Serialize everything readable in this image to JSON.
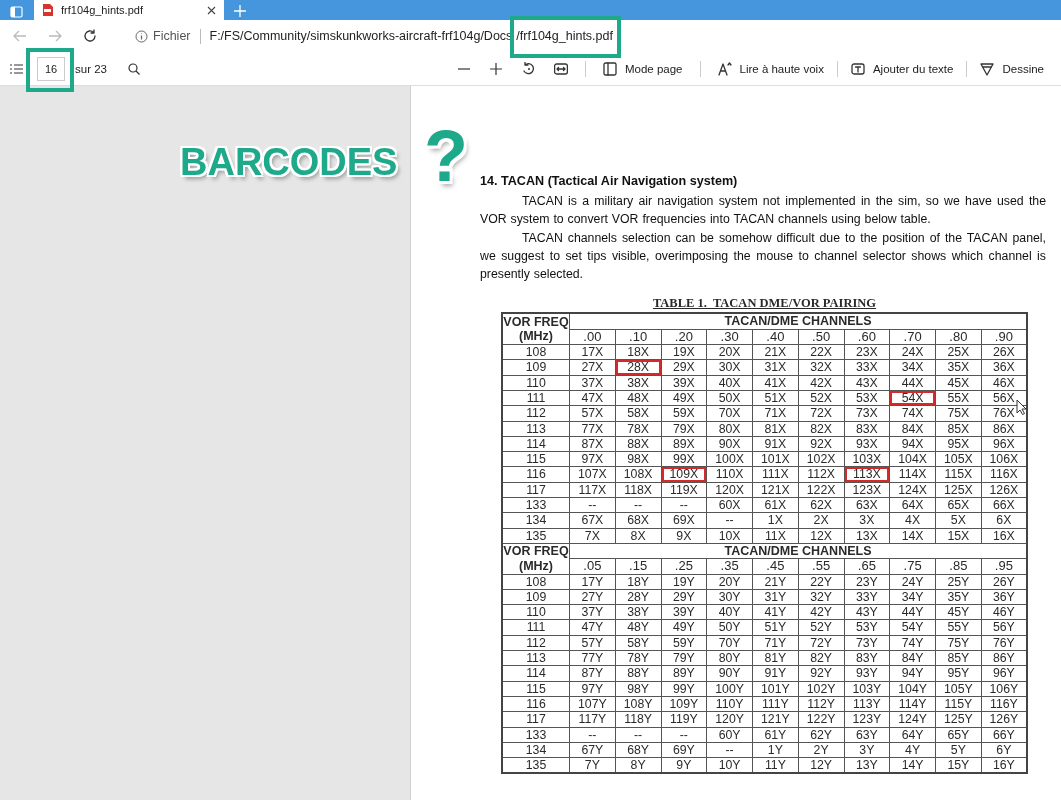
{
  "browser": {
    "tab_title": "frf104g_hints.pdf",
    "scheme_label": "Fichier",
    "url_path": "F:/FS/Community/simskunkworks-aircraft-frf104g/Docs",
    "url_file": "/frf104g_hints.pdf",
    "url_file_highlighted": true
  },
  "pdf_toolbar": {
    "page": "16",
    "page_highlighted": true,
    "page_total": "sur 23",
    "buttons": [
      {
        "kind": "pagemode",
        "label": "Mode page"
      },
      {
        "kind": "read",
        "label": "Lire à haute voix"
      },
      {
        "kind": "text",
        "label": "Ajouter du texte"
      },
      {
        "kind": "draw",
        "label": "Dessine"
      }
    ]
  },
  "annotation": {
    "label": "BARCODES",
    "mark": "?"
  },
  "document": {
    "heading": "14. TACAN (Tactical Air Navigation system)",
    "paragraphs": [
      "TACAN is a military air navigation system not implemented  in the sim, so we have used the VOR system to convert VOR frequencies into TACAN channels using below table.",
      "TACAN channels selection can be somehow difficult due to the position of the TACAN panel, we suggest to set tips visible, overimposing the mouse to channel selector shows which channel is presently selected."
    ],
    "table": {
      "caption": "TABLE 1.  TACAN DME/VOR PAIRING",
      "blocks": [
        {
          "freq_label": "VOR FREQ",
          "freq_unit": "(MHz)",
          "group_label": "TACAN/DME CHANNELS",
          "columns": [
            ".00",
            ".10",
            ".20",
            ".30",
            ".40",
            ".50",
            ".60",
            ".70",
            ".80",
            ".90"
          ],
          "rows": [
            {
              "freq": "108",
              "cells": [
                {
                  "text": "17X",
                  "boxed": false
                },
                {
                  "text": "18X",
                  "boxed": false
                },
                {
                  "text": "19X",
                  "boxed": false
                },
                {
                  "text": "20X",
                  "boxed": false
                },
                {
                  "text": "21X",
                  "boxed": false
                },
                {
                  "text": "22X",
                  "boxed": false
                },
                {
                  "text": "23X",
                  "boxed": false
                },
                {
                  "text": "24X",
                  "boxed": false
                },
                {
                  "text": "25X",
                  "boxed": false
                },
                {
                  "text": "26X",
                  "boxed": false
                }
              ]
            },
            {
              "freq": "109",
              "cells": [
                {
                  "text": "27X",
                  "boxed": false
                },
                {
                  "text": "28X",
                  "boxed": true
                },
                {
                  "text": "29X",
                  "boxed": false
                },
                {
                  "text": "30X",
                  "boxed": false
                },
                {
                  "text": "31X",
                  "boxed": false
                },
                {
                  "text": "32X",
                  "boxed": false
                },
                {
                  "text": "33X",
                  "boxed": false
                },
                {
                  "text": "34X",
                  "boxed": false
                },
                {
                  "text": "35X",
                  "boxed": false
                },
                {
                  "text": "36X",
                  "boxed": false
                }
              ]
            },
            {
              "freq": "110",
              "cells": [
                {
                  "text": "37X",
                  "boxed": false
                },
                {
                  "text": "38X",
                  "boxed": false
                },
                {
                  "text": "39X",
                  "boxed": false
                },
                {
                  "text": "40X",
                  "boxed": false
                },
                {
                  "text": "41X",
                  "boxed": false
                },
                {
                  "text": "42X",
                  "boxed": false
                },
                {
                  "text": "43X",
                  "boxed": false
                },
                {
                  "text": "44X",
                  "boxed": false
                },
                {
                  "text": "45X",
                  "boxed": false
                },
                {
                  "text": "46X",
                  "boxed": false
                }
              ]
            },
            {
              "freq": "111",
              "cells": [
                {
                  "text": "47X",
                  "boxed": false
                },
                {
                  "text": "48X",
                  "boxed": false
                },
                {
                  "text": "49X",
                  "boxed": false
                },
                {
                  "text": "50X",
                  "boxed": false
                },
                {
                  "text": "51X",
                  "boxed": false
                },
                {
                  "text": "52X",
                  "boxed": false
                },
                {
                  "text": "53X",
                  "boxed": false
                },
                {
                  "text": "54X",
                  "boxed": true
                },
                {
                  "text": "55X",
                  "boxed": false
                },
                {
                  "text": "56X",
                  "boxed": false
                }
              ]
            },
            {
              "freq": "112",
              "cells": [
                {
                  "text": "57X",
                  "boxed": false
                },
                {
                  "text": "58X",
                  "boxed": false
                },
                {
                  "text": "59X",
                  "boxed": false
                },
                {
                  "text": "70X",
                  "boxed": false
                },
                {
                  "text": "71X",
                  "boxed": false
                },
                {
                  "text": "72X",
                  "boxed": false
                },
                {
                  "text": "73X",
                  "boxed": false
                },
                {
                  "text": "74X",
                  "boxed": false
                },
                {
                  "text": "75X",
                  "boxed": false
                },
                {
                  "text": "76X",
                  "boxed": false
                }
              ]
            },
            {
              "freq": "113",
              "cells": [
                {
                  "text": "77X",
                  "boxed": false
                },
                {
                  "text": "78X",
                  "boxed": false
                },
                {
                  "text": "79X",
                  "boxed": false
                },
                {
                  "text": "80X",
                  "boxed": false
                },
                {
                  "text": "81X",
                  "boxed": false
                },
                {
                  "text": "82X",
                  "boxed": false
                },
                {
                  "text": "83X",
                  "boxed": false
                },
                {
                  "text": "84X",
                  "boxed": false
                },
                {
                  "text": "85X",
                  "boxed": false
                },
                {
                  "text": "86X",
                  "boxed": false
                }
              ]
            },
            {
              "freq": "114",
              "cells": [
                {
                  "text": "87X",
                  "boxed": false
                },
                {
                  "text": "88X",
                  "boxed": false
                },
                {
                  "text": "89X",
                  "boxed": false
                },
                {
                  "text": "90X",
                  "boxed": false
                },
                {
                  "text": "91X",
                  "boxed": false
                },
                {
                  "text": "92X",
                  "boxed": false
                },
                {
                  "text": "93X",
                  "boxed": false
                },
                {
                  "text": "94X",
                  "boxed": false
                },
                {
                  "text": "95X",
                  "boxed": false
                },
                {
                  "text": "96X",
                  "boxed": false
                }
              ]
            },
            {
              "freq": "115",
              "cells": [
                {
                  "text": "97X",
                  "boxed": false
                },
                {
                  "text": "98X",
                  "boxed": false
                },
                {
                  "text": "99X",
                  "boxed": false
                },
                {
                  "text": "100X",
                  "boxed": false
                },
                {
                  "text": "101X",
                  "boxed": false
                },
                {
                  "text": "102X",
                  "boxed": false
                },
                {
                  "text": "103X",
                  "boxed": false
                },
                {
                  "text": "104X",
                  "boxed": false
                },
                {
                  "text": "105X",
                  "boxed": false
                },
                {
                  "text": "106X",
                  "boxed": false
                }
              ]
            },
            {
              "freq": "116",
              "cells": [
                {
                  "text": "107X",
                  "boxed": false
                },
                {
                  "text": "108X",
                  "boxed": false
                },
                {
                  "text": "109X",
                  "boxed": true
                },
                {
                  "text": "110X",
                  "boxed": false
                },
                {
                  "text": "111X",
                  "boxed": false
                },
                {
                  "text": "112X",
                  "boxed": false
                },
                {
                  "text": "113X",
                  "boxed": true
                },
                {
                  "text": "114X",
                  "boxed": false
                },
                {
                  "text": "115X",
                  "boxed": false
                },
                {
                  "text": "116X",
                  "boxed": false
                }
              ]
            },
            {
              "freq": "117",
              "cells": [
                {
                  "text": "117X",
                  "boxed": false
                },
                {
                  "text": "118X",
                  "boxed": false
                },
                {
                  "text": "119X",
                  "boxed": false
                },
                {
                  "text": "120X",
                  "boxed": false
                },
                {
                  "text": "121X",
                  "boxed": false
                },
                {
                  "text": "122X",
                  "boxed": false
                },
                {
                  "text": "123X",
                  "boxed": false
                },
                {
                  "text": "124X",
                  "boxed": false
                },
                {
                  "text": "125X",
                  "boxed": false
                },
                {
                  "text": "126X",
                  "boxed": false
                }
              ]
            },
            {
              "freq": "133",
              "cells": [
                {
                  "text": "--",
                  "boxed": false
                },
                {
                  "text": "--",
                  "boxed": false
                },
                {
                  "text": "--",
                  "boxed": false
                },
                {
                  "text": "60X",
                  "boxed": false
                },
                {
                  "text": "61X",
                  "boxed": false
                },
                {
                  "text": "62X",
                  "boxed": false
                },
                {
                  "text": "63X",
                  "boxed": false
                },
                {
                  "text": "64X",
                  "boxed": false
                },
                {
                  "text": "65X",
                  "boxed": false
                },
                {
                  "text": "66X",
                  "boxed": false
                }
              ]
            },
            {
              "freq": "134",
              "cells": [
                {
                  "text": "67X",
                  "boxed": false
                },
                {
                  "text": "68X",
                  "boxed": false
                },
                {
                  "text": "69X",
                  "boxed": false
                },
                {
                  "text": "--",
                  "boxed": false
                },
                {
                  "text": "1X",
                  "boxed": false
                },
                {
                  "text": "2X",
                  "boxed": false
                },
                {
                  "text": "3X",
                  "boxed": false
                },
                {
                  "text": "4X",
                  "boxed": false
                },
                {
                  "text": "5X",
                  "boxed": false
                },
                {
                  "text": "6X",
                  "boxed": false
                }
              ]
            },
            {
              "freq": "135",
              "cells": [
                {
                  "text": "7X",
                  "boxed": false
                },
                {
                  "text": "8X",
                  "boxed": false
                },
                {
                  "text": "9X",
                  "boxed": false
                },
                {
                  "text": "10X",
                  "boxed": false
                },
                {
                  "text": "11X",
                  "boxed": false
                },
                {
                  "text": "12X",
                  "boxed": false
                },
                {
                  "text": "13X",
                  "boxed": false
                },
                {
                  "text": "14X",
                  "boxed": false
                },
                {
                  "text": "15X",
                  "boxed": false
                },
                {
                  "text": "16X",
                  "boxed": false
                }
              ]
            }
          ]
        },
        {
          "freq_label": "VOR FREQ",
          "freq_unit": "(MHz)",
          "group_label": "TACAN/DME CHANNELS",
          "columns": [
            ".05",
            ".15",
            ".25",
            ".35",
            ".45",
            ".55",
            ".65",
            ".75",
            ".85",
            ".95"
          ],
          "rows": [
            {
              "freq": "108",
              "cells": [
                {
                  "text": "17Y",
                  "boxed": false
                },
                {
                  "text": "18Y",
                  "boxed": false
                },
                {
                  "text": "19Y",
                  "boxed": false
                },
                {
                  "text": "20Y",
                  "boxed": false
                },
                {
                  "text": "21Y",
                  "boxed": false
                },
                {
                  "text": "22Y",
                  "boxed": false
                },
                {
                  "text": "23Y",
                  "boxed": false
                },
                {
                  "text": "24Y",
                  "boxed": false
                },
                {
                  "text": "25Y",
                  "boxed": false
                },
                {
                  "text": "26Y",
                  "boxed": false
                }
              ]
            },
            {
              "freq": "109",
              "cells": [
                {
                  "text": "27Y",
                  "boxed": false
                },
                {
                  "text": "28Y",
                  "boxed": false
                },
                {
                  "text": "29Y",
                  "boxed": false
                },
                {
                  "text": "30Y",
                  "boxed": false
                },
                {
                  "text": "31Y",
                  "boxed": false
                },
                {
                  "text": "32Y",
                  "boxed": false
                },
                {
                  "text": "33Y",
                  "boxed": false
                },
                {
                  "text": "34Y",
                  "boxed": false
                },
                {
                  "text": "35Y",
                  "boxed": false
                },
                {
                  "text": "36Y",
                  "boxed": false
                }
              ]
            },
            {
              "freq": "110",
              "cells": [
                {
                  "text": "37Y",
                  "boxed": false
                },
                {
                  "text": "38Y",
                  "boxed": false
                },
                {
                  "text": "39Y",
                  "boxed": false
                },
                {
                  "text": "40Y",
                  "boxed": false
                },
                {
                  "text": "41Y",
                  "boxed": false
                },
                {
                  "text": "42Y",
                  "boxed": false
                },
                {
                  "text": "43Y",
                  "boxed": false
                },
                {
                  "text": "44Y",
                  "boxed": false
                },
                {
                  "text": "45Y",
                  "boxed": false
                },
                {
                  "text": "46Y",
                  "boxed": false
                }
              ]
            },
            {
              "freq": "111",
              "cells": [
                {
                  "text": "47Y",
                  "boxed": false
                },
                {
                  "text": "48Y",
                  "boxed": false
                },
                {
                  "text": "49Y",
                  "boxed": false
                },
                {
                  "text": "50Y",
                  "boxed": false
                },
                {
                  "text": "51Y",
                  "boxed": false
                },
                {
                  "text": "52Y",
                  "boxed": false
                },
                {
                  "text": "53Y",
                  "boxed": false
                },
                {
                  "text": "54Y",
                  "boxed": false
                },
                {
                  "text": "55Y",
                  "boxed": false
                },
                {
                  "text": "56Y",
                  "boxed": false
                }
              ]
            },
            {
              "freq": "112",
              "cells": [
                {
                  "text": "57Y",
                  "boxed": false
                },
                {
                  "text": "58Y",
                  "boxed": false
                },
                {
                  "text": "59Y",
                  "boxed": false
                },
                {
                  "text": "70Y",
                  "boxed": false
                },
                {
                  "text": "71Y",
                  "boxed": false
                },
                {
                  "text": "72Y",
                  "boxed": false
                },
                {
                  "text": "73Y",
                  "boxed": false
                },
                {
                  "text": "74Y",
                  "boxed": false
                },
                {
                  "text": "75Y",
                  "boxed": false
                },
                {
                  "text": "76Y",
                  "boxed": false
                }
              ]
            },
            {
              "freq": "113",
              "cells": [
                {
                  "text": "77Y",
                  "boxed": false
                },
                {
                  "text": "78Y",
                  "boxed": false
                },
                {
                  "text": "79Y",
                  "boxed": false
                },
                {
                  "text": "80Y",
                  "boxed": false
                },
                {
                  "text": "81Y",
                  "boxed": false
                },
                {
                  "text": "82Y",
                  "boxed": false
                },
                {
                  "text": "83Y",
                  "boxed": false
                },
                {
                  "text": "84Y",
                  "boxed": false
                },
                {
                  "text": "85Y",
                  "boxed": false
                },
                {
                  "text": "86Y",
                  "boxed": false
                }
              ]
            },
            {
              "freq": "114",
              "cells": [
                {
                  "text": "87Y",
                  "boxed": false
                },
                {
                  "text": "88Y",
                  "boxed": false
                },
                {
                  "text": "89Y",
                  "boxed": false
                },
                {
                  "text": "90Y",
                  "boxed": false
                },
                {
                  "text": "91Y",
                  "boxed": false
                },
                {
                  "text": "92Y",
                  "boxed": false
                },
                {
                  "text": "93Y",
                  "boxed": false
                },
                {
                  "text": "94Y",
                  "boxed": false
                },
                {
                  "text": "95Y",
                  "boxed": false
                },
                {
                  "text": "96Y",
                  "boxed": false
                }
              ]
            },
            {
              "freq": "115",
              "cells": [
                {
                  "text": "97Y",
                  "boxed": false
                },
                {
                  "text": "98Y",
                  "boxed": false
                },
                {
                  "text": "99Y",
                  "boxed": false
                },
                {
                  "text": "100Y",
                  "boxed": false
                },
                {
                  "text": "101Y",
                  "boxed": false
                },
                {
                  "text": "102Y",
                  "boxed": false
                },
                {
                  "text": "103Y",
                  "boxed": false
                },
                {
                  "text": "104Y",
                  "boxed": false
                },
                {
                  "text": "105Y",
                  "boxed": false
                },
                {
                  "text": "106Y",
                  "boxed": false
                }
              ]
            },
            {
              "freq": "116",
              "cells": [
                {
                  "text": "107Y",
                  "boxed": false
                },
                {
                  "text": "108Y",
                  "boxed": false
                },
                {
                  "text": "109Y",
                  "boxed": false
                },
                {
                  "text": "110Y",
                  "boxed": false
                },
                {
                  "text": "111Y",
                  "boxed": false
                },
                {
                  "text": "112Y",
                  "boxed": false
                },
                {
                  "text": "113Y",
                  "boxed": false
                },
                {
                  "text": "114Y",
                  "boxed": false
                },
                {
                  "text": "115Y",
                  "boxed": false
                },
                {
                  "text": "116Y",
                  "boxed": false
                }
              ]
            },
            {
              "freq": "117",
              "cells": [
                {
                  "text": "117Y",
                  "boxed": false
                },
                {
                  "text": "118Y",
                  "boxed": false
                },
                {
                  "text": "119Y",
                  "boxed": false
                },
                {
                  "text": "120Y",
                  "boxed": false
                },
                {
                  "text": "121Y",
                  "boxed": false
                },
                {
                  "text": "122Y",
                  "boxed": false
                },
                {
                  "text": "123Y",
                  "boxed": false
                },
                {
                  "text": "124Y",
                  "boxed": false
                },
                {
                  "text": "125Y",
                  "boxed": false
                },
                {
                  "text": "126Y",
                  "boxed": false
                }
              ]
            },
            {
              "freq": "133",
              "cells": [
                {
                  "text": "--",
                  "boxed": false
                },
                {
                  "text": "--",
                  "boxed": false
                },
                {
                  "text": "--",
                  "boxed": false
                },
                {
                  "text": "60Y",
                  "boxed": false
                },
                {
                  "text": "61Y",
                  "boxed": false
                },
                {
                  "text": "62Y",
                  "boxed": false
                },
                {
                  "text": "63Y",
                  "boxed": false
                },
                {
                  "text": "64Y",
                  "boxed": false
                },
                {
                  "text": "65Y",
                  "boxed": false
                },
                {
                  "text": "66Y",
                  "boxed": false
                }
              ]
            },
            {
              "freq": "134",
              "cells": [
                {
                  "text": "67Y",
                  "boxed": false
                },
                {
                  "text": "68Y",
                  "boxed": false
                },
                {
                  "text": "69Y",
                  "boxed": false
                },
                {
                  "text": "--",
                  "boxed": false
                },
                {
                  "text": "1Y",
                  "boxed": false
                },
                {
                  "text": "2Y",
                  "boxed": false
                },
                {
                  "text": "3Y",
                  "boxed": false
                },
                {
                  "text": "4Y",
                  "boxed": false
                },
                {
                  "text": "5Y",
                  "boxed": false
                },
                {
                  "text": "6Y",
                  "boxed": false
                }
              ]
            },
            {
              "freq": "135",
              "cells": [
                {
                  "text": "7Y",
                  "boxed": false
                },
                {
                  "text": "8Y",
                  "boxed": false
                },
                {
                  "text": "9Y",
                  "boxed": false
                },
                {
                  "text": "10Y",
                  "boxed": false
                },
                {
                  "text": "11Y",
                  "boxed": false
                },
                {
                  "text": "12Y",
                  "boxed": false
                },
                {
                  "text": "13Y",
                  "boxed": false
                },
                {
                  "text": "14Y",
                  "boxed": false
                },
                {
                  "text": "15Y",
                  "boxed": false
                },
                {
                  "text": "16Y",
                  "boxed": false
                }
              ]
            }
          ]
        }
      ]
    }
  }
}
